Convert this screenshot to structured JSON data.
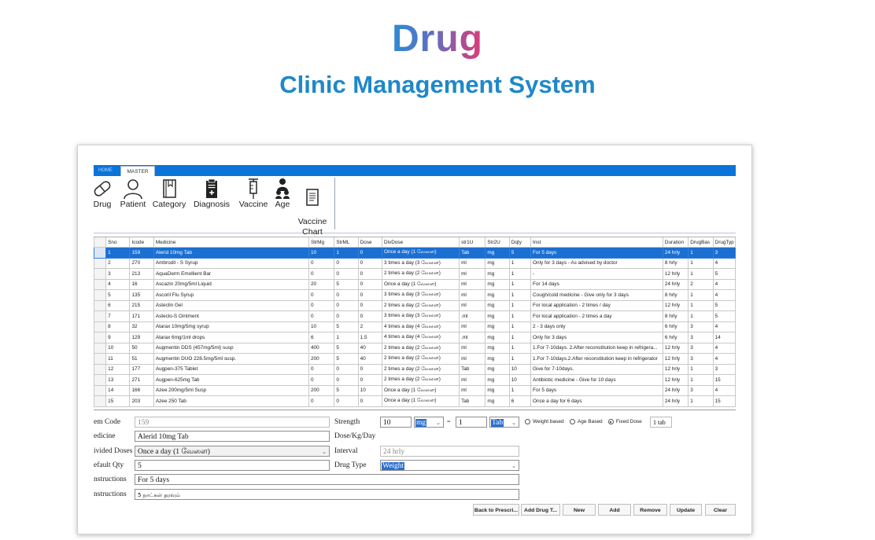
{
  "hero": {
    "title": "Drug",
    "subtitle": "Clinic Management System"
  },
  "ribbon": {
    "tabs": [
      "HOME",
      "MASTER"
    ]
  },
  "toolbar": {
    "items": [
      {
        "label": "Drug",
        "icon": "pill-icon"
      },
      {
        "label": "Patient",
        "icon": "patient-icon"
      },
      {
        "label": "Category",
        "icon": "book-icon"
      },
      {
        "label": "Diagnosis",
        "icon": "clipboard-icon"
      },
      {
        "label": "Vaccine",
        "icon": "syringe-icon"
      },
      {
        "label": "Age",
        "icon": "family-icon"
      },
      {
        "label": "Vaccine\nChart",
        "icon": "document-icon"
      }
    ]
  },
  "grid": {
    "columns": [
      "Sno",
      "Icode",
      "Medicine",
      "StrMg",
      "StrML",
      "Dose",
      "DivDose",
      "str1U",
      "Str2U",
      "Dqty",
      "Inst",
      "Duration",
      "DrugBas",
      "DrugTyp"
    ],
    "rows": [
      [
        "1",
        "159",
        "Alerid 10mg Tab",
        "10",
        "1",
        "0",
        "Once a day  (1 வேளை)",
        "Tab",
        "mg",
        "5",
        "For 5 days",
        "24 hrly",
        "1",
        "3"
      ],
      [
        "2",
        "270",
        "Ambrodil - S Syrup",
        "0",
        "0",
        "0",
        "3 times a day (3 வேளை)",
        "ml",
        "mg",
        "1",
        "Only for 3 days - As advised by doctor",
        "8 hrly",
        "1",
        "4"
      ],
      [
        "3",
        "213",
        "AquaDerm Emollient Bar",
        "0",
        "0",
        "0",
        "2 times a day (2 வேளை)",
        "ml",
        "mg",
        "1",
        "-",
        "12 hrly",
        "1",
        "5"
      ],
      [
        "4",
        "16",
        "Ascazin 20mg/5ml Liquid",
        "20",
        "5",
        "0",
        "Once a day  (1 வேளை)",
        "ml",
        "mg",
        "1",
        "For 14 days",
        "24 hrly",
        "2",
        "4"
      ],
      [
        "5",
        "135",
        "Ascoril Flu Syrup",
        "0",
        "0",
        "0",
        "3 times a day (3 வேளை)",
        "ml",
        "mg",
        "1",
        "Cough/cold medicine - Give only for 3 days",
        "8 hrly",
        "1",
        "4"
      ],
      [
        "6",
        "215",
        "Asteclin Gel",
        "0",
        "0",
        "0",
        "2 times a day (2 வேளை)",
        "ml",
        "mg",
        "1",
        "For local application - 2 times / day",
        "12 hrly",
        "1",
        "5"
      ],
      [
        "7",
        "171",
        "Asteclo-S Ointment",
        "0",
        "0",
        "0",
        "3 times a day (3 வேளை)",
        ".ml",
        "mg",
        "1",
        "For local application - 2 times a day",
        "8 hrly",
        "1",
        "5"
      ],
      [
        "8",
        "32",
        "Atarax 10mg/5mg syrup",
        "10",
        "5",
        "2",
        "4 times a day (4 வேளை)",
        "ml",
        "mg",
        "1",
        "2 - 3 days only",
        "6 hrly",
        "3",
        "4"
      ],
      [
        "9",
        "129",
        "Atarax 6mg/1ml drops",
        "6",
        "1",
        "1.5",
        "4 times a day (4 வேளை)",
        ".ml",
        "mg",
        "1",
        "Only for 3 days",
        "6 hrly",
        "3",
        "14"
      ],
      [
        "10",
        "50",
        "Augmentin DDS (457mg/5ml) susp",
        "400",
        "5",
        "40",
        "2 times a day (2 வேளை)",
        "ml",
        "mg",
        "1",
        "1.For 7-10days. 2.After reconstitution keep in refrigera...",
        "12 hrly",
        "3",
        "4"
      ],
      [
        "11",
        "51",
        "Augmentin DUO 228.5mg/5ml  susp.",
        "200",
        "5",
        "40",
        "2 times a day (2 வேளை)",
        "ml",
        "mg",
        "1",
        "1.For 7-10days.2.After reconstitution keep in refrigerator",
        "12 hrly",
        "3",
        "4"
      ],
      [
        "12",
        "177",
        "Augpen-375 Tablet",
        "0",
        "0",
        "0",
        "2 times a day (2 வேளை)",
        "Tab",
        "mg",
        "10",
        "Give for 7-10days.",
        "12 hrly",
        "1",
        "3"
      ],
      [
        "13",
        "271",
        "Augpen-625mg Tab",
        "0",
        "0",
        "0",
        "2 times a day (2 வேளை)",
        "ml",
        "mg",
        "10",
        "Antibiotic medicine - Give for 10 days",
        "12 hrly",
        "1",
        "15"
      ],
      [
        "14",
        "166",
        "Azee 200mg/5ml Susp",
        "200",
        "5",
        "10",
        "Once a day  (1 வேளை)",
        "ml",
        "mg",
        "1",
        "For 5 days",
        "24 hrly",
        "3",
        "4"
      ],
      [
        "15",
        "203",
        "Azee 250 Tab",
        "0",
        "0",
        "0",
        "Once a day  (1 வேளை)",
        "Tab",
        "mg",
        "6",
        "Once a day for 6 days",
        "24 hrly",
        "1",
        "15"
      ]
    ]
  },
  "form": {
    "item_code_label": "em Code",
    "item_code_value": "159",
    "medicine_label": "edicine",
    "medicine_value": "Alerid 10mg Tab",
    "divided_doses_label": "ivided Doses",
    "divided_doses_value": "Once a day  (1 வேளை)",
    "default_qty_label": "efault Qty",
    "default_qty_value": "5",
    "instructions_label": "nstructions",
    "instructions_value": "For 5 days",
    "instructions2_label": "nstructions",
    "instructions2_value": "5 நாட்கள் தரவும்",
    "strength_label": "Strength",
    "strength_value1": "10",
    "strength_unit1": "mg",
    "strength_sep": "=",
    "strength_value2": "1",
    "strength_unit2": "Tab",
    "dose_kg_label": "Dose/Kg/Day",
    "interval_label": "Interval",
    "interval_value": "24 hrly",
    "drug_type_label": "Drug Type",
    "drug_type_value": "Weight",
    "radio_weight": "Weight based",
    "radio_age": "Age Based",
    "radio_fixed": "Fixed Dose",
    "fixed_dose_value": "1 tab"
  },
  "buttons": {
    "back": "Back to Prescri...",
    "add_drug": "Add Drug T...",
    "new": "New",
    "add": "Add",
    "remove": "Remove",
    "update": "Update",
    "clear": "Clear"
  },
  "colors": {
    "ribbon": "#0a74d9",
    "selected_row": "#1b6fd1",
    "subtitle": "#1f88c9"
  }
}
